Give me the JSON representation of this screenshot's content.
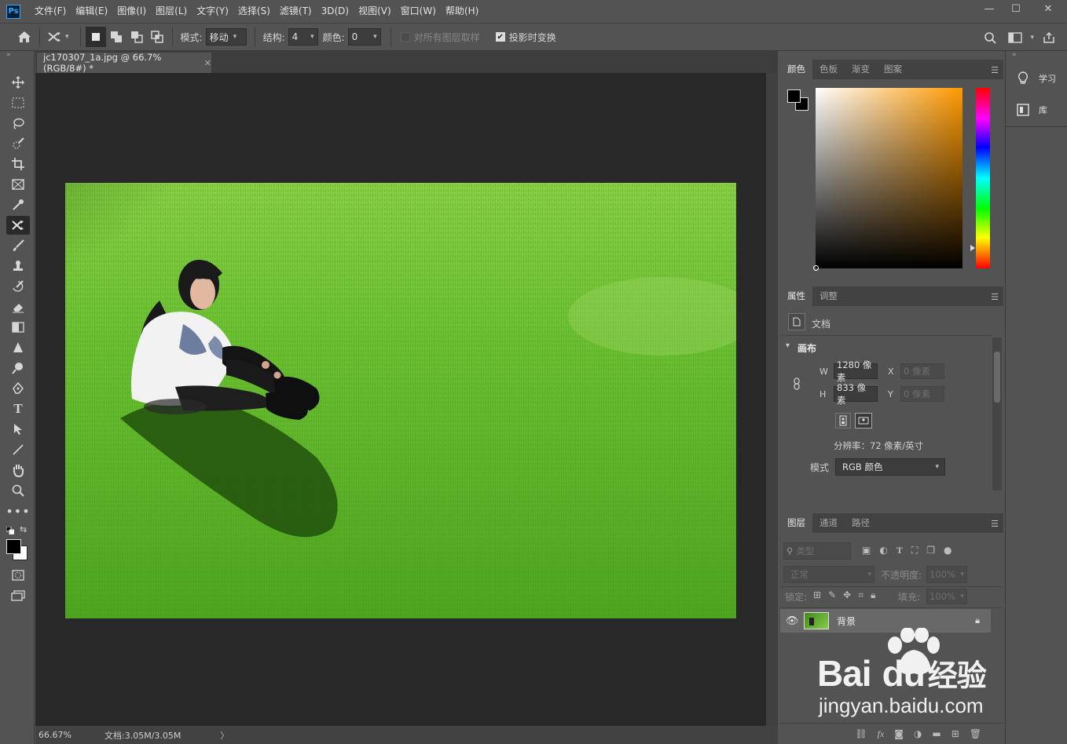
{
  "app": {
    "logo_text": "Ps"
  },
  "menu": [
    "文件(F)",
    "编辑(E)",
    "图像(I)",
    "图层(L)",
    "文字(Y)",
    "选择(S)",
    "滤镜(T)",
    "3D(D)",
    "视图(V)",
    "窗口(W)",
    "帮助(H)"
  ],
  "window_controls": {
    "minimize": "—",
    "maximize": "☐",
    "close": "✕"
  },
  "options": {
    "mode_label": "模式:",
    "mode_value": "移动",
    "structure_label": "结构:",
    "structure_value": "4",
    "color_label": "颜色:",
    "color_value": "0",
    "sample_all_label": "对所有图层取样",
    "transform_label": "投影时变换"
  },
  "document": {
    "tab_title": "jc170307_1a.jpg @ 66.7%(RGB/8#) *",
    "zoom": "66.67%",
    "doc_size": "文档:3.05M/3.05M",
    "status_arrow": "〉"
  },
  "color_panel": {
    "tabs": [
      "颜色",
      "色板",
      "渐变",
      "图案"
    ],
    "active_tab": 0
  },
  "properties_panel": {
    "tabs": [
      "属性",
      "调整"
    ],
    "active_tab": 0,
    "doc_label": "文档",
    "section": "画布",
    "w_label": "W",
    "w_value": "1280 像素",
    "h_label": "H",
    "h_value": "833 像素",
    "x_label": "X",
    "x_value": "0 像素",
    "y_label": "Y",
    "y_value": "0 像素",
    "resolution": "分辨率：72 像素/英寸",
    "mode_label": "模式",
    "mode_value": "RGB 颜色"
  },
  "layers_panel": {
    "tabs": [
      "图层",
      "通道",
      "路径"
    ],
    "active_tab": 0,
    "filter_placeholder": "类型",
    "blend_mode": "正常",
    "opacity_label": "不透明度:",
    "opacity_value": "100%",
    "lock_label": "锁定:",
    "fill_label": "填充:",
    "fill_value": "100%",
    "layers": [
      {
        "name": "背景",
        "locked": true,
        "visible": true
      }
    ]
  },
  "right_dock": {
    "items": [
      "学习",
      "库"
    ]
  },
  "watermark": {
    "brand": "Bai",
    "brand2": "du",
    "service": "经验",
    "url": "jingyan.baidu.com"
  },
  "colors": {
    "fg": "#000000",
    "bg": "#ffffff",
    "hue": "#ff9900",
    "accent": "#31a8ff"
  }
}
